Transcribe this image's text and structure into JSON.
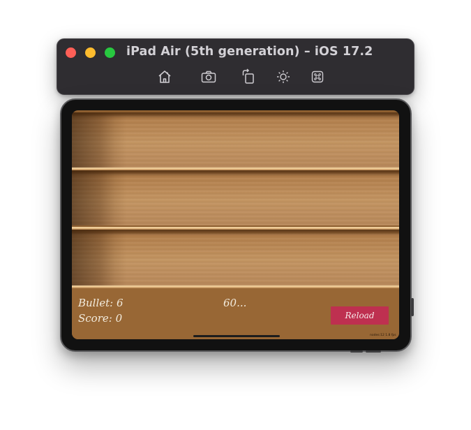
{
  "window": {
    "title": "iPad Air (5th generation) – iOS 17.2",
    "toolbar_icons": [
      "home-icon",
      "screenshot-camera-icon",
      "rotate-icon",
      "brightness-icon",
      "command-icon"
    ]
  },
  "game": {
    "bullet_label": "Bullet: 6",
    "score_label": "Score: 0",
    "timer": "60...",
    "reload_label": "Reload",
    "debug_stats": "nodes:12  1.8 fps",
    "shelves": 3
  },
  "colors": {
    "close": "#fe5f57",
    "minimize": "#febc2e",
    "zoom": "#28c840",
    "reload_button": "#be3050",
    "hud_bar": "#986735"
  }
}
